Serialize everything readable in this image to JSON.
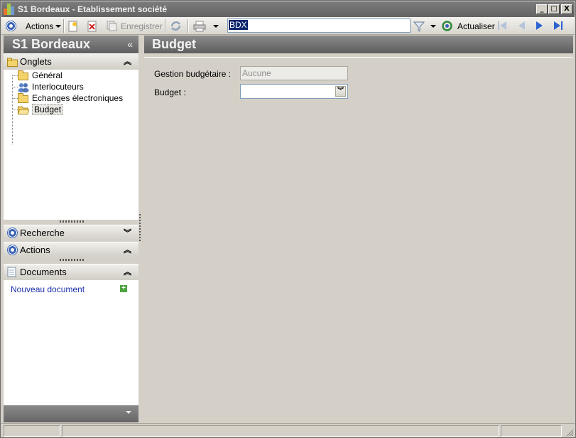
{
  "window": {
    "title": "S1 Bordeaux - Etablissement société",
    "min_glyph": "_",
    "max_glyph": "□",
    "close_glyph": "X"
  },
  "toolbar": {
    "actions_label": "Actions",
    "save_label": "Enregistrer",
    "search_value": "BDX",
    "refresh_label": "Actualiser"
  },
  "sidebar": {
    "title": "S1 Bordeaux",
    "collapse_glyph": "«",
    "tabs_section": {
      "label": "Onglets",
      "chevron": "⌃",
      "items": [
        {
          "label": "Général",
          "icon": "folder-icon"
        },
        {
          "label": "Interlocuteurs",
          "icon": "people-icon"
        },
        {
          "label": "Echanges électroniques",
          "icon": "folder-icon"
        },
        {
          "label": "Budget",
          "icon": "folder-open-icon",
          "selected": true
        }
      ]
    },
    "search_section": {
      "label": "Recherche",
      "chevron": "⌄"
    },
    "actions_section": {
      "label": "Actions",
      "chevron": "⌃"
    },
    "documents_section": {
      "label": "Documents",
      "chevron": "⌃",
      "new_document_label": "Nouveau document"
    }
  },
  "main": {
    "title": "Budget",
    "fields": [
      {
        "label": "Gestion budgétaire :",
        "value": "Aucune",
        "readonly": true
      },
      {
        "label": "Budget :",
        "value": ""
      }
    ]
  },
  "colors": {
    "header_bg": "#6e6e6e",
    "link": "#1a2fa8",
    "accent_blue": "#3b64b5"
  }
}
